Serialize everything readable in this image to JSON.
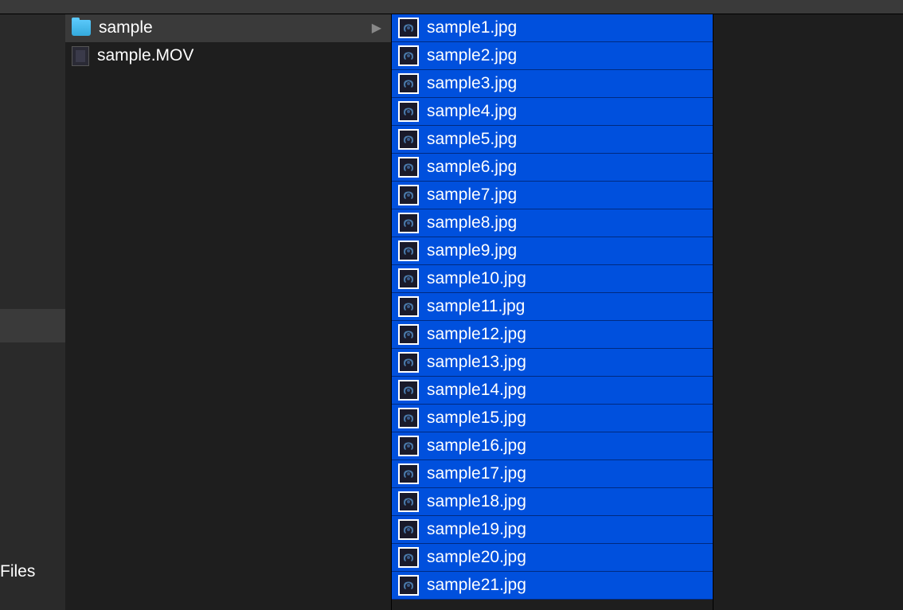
{
  "sidebar": {
    "files_label": "Files"
  },
  "column1": {
    "items": [
      {
        "type": "folder",
        "label": "sample",
        "selected": true,
        "has_children": true
      },
      {
        "type": "mov",
        "label": "sample.MOV",
        "selected": false,
        "has_children": false
      }
    ]
  },
  "column2": {
    "items": [
      {
        "label": "sample1.jpg"
      },
      {
        "label": "sample2.jpg"
      },
      {
        "label": "sample3.jpg"
      },
      {
        "label": "sample4.jpg"
      },
      {
        "label": "sample5.jpg"
      },
      {
        "label": "sample6.jpg"
      },
      {
        "label": "sample7.jpg"
      },
      {
        "label": "sample8.jpg"
      },
      {
        "label": "sample9.jpg"
      },
      {
        "label": "sample10.jpg"
      },
      {
        "label": "sample11.jpg"
      },
      {
        "label": "sample12.jpg"
      },
      {
        "label": "sample13.jpg"
      },
      {
        "label": "sample14.jpg"
      },
      {
        "label": "sample15.jpg"
      },
      {
        "label": "sample16.jpg"
      },
      {
        "label": "sample17.jpg"
      },
      {
        "label": "sample18.jpg"
      },
      {
        "label": "sample19.jpg"
      },
      {
        "label": "sample20.jpg"
      },
      {
        "label": "sample21.jpg"
      }
    ]
  }
}
